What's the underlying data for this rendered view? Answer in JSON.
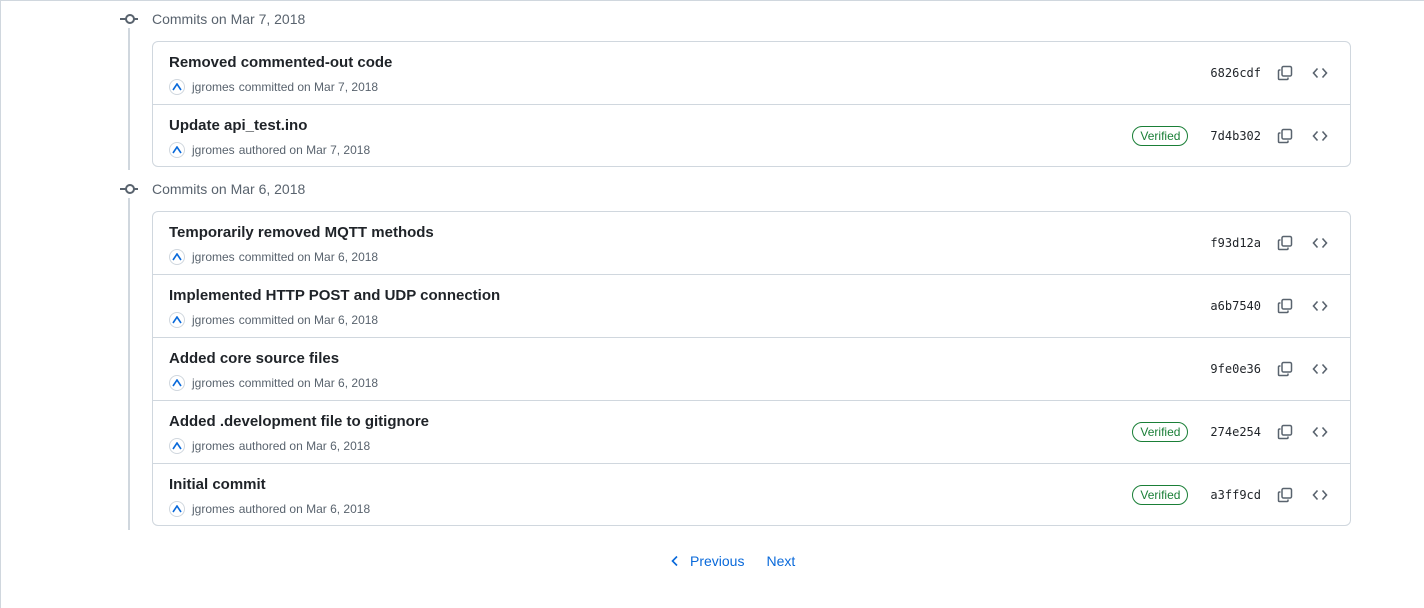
{
  "groups": [
    {
      "title": "Commits on Mar 7, 2018",
      "commits": [
        {
          "message": "Removed commented-out code",
          "author": "jgromes",
          "action": "committed on Mar 7, 2018",
          "verified": "",
          "sha": "6826cdf"
        },
        {
          "message": "Update api_test.ino",
          "author": "jgromes",
          "action": "authored on Mar 7, 2018",
          "verified": "Verified",
          "sha": "7d4b302"
        }
      ]
    },
    {
      "title": "Commits on Mar 6, 2018",
      "commits": [
        {
          "message": "Temporarily removed MQTT methods",
          "author": "jgromes",
          "action": "committed on Mar 6, 2018",
          "verified": "",
          "sha": "f93d12a"
        },
        {
          "message": "Implemented HTTP POST and UDP connection",
          "author": "jgromes",
          "action": "committed on Mar 6, 2018",
          "verified": "",
          "sha": "a6b7540"
        },
        {
          "message": "Added core source files",
          "author": "jgromes",
          "action": "committed on Mar 6, 2018",
          "verified": "",
          "sha": "9fe0e36"
        },
        {
          "message": "Added .development file to gitignore",
          "author": "jgromes",
          "action": "authored on Mar 6, 2018",
          "verified": "Verified",
          "sha": "274e254"
        },
        {
          "message": "Initial commit",
          "author": "jgromes",
          "action": "authored on Mar 6, 2018",
          "verified": "Verified",
          "sha": "a3ff9cd"
        }
      ]
    }
  ],
  "pagination": {
    "previous": "Previous",
    "next": "Next"
  },
  "colors": {
    "link": "#0969da",
    "verified": "#1a7f37",
    "border": "#d0d7de",
    "muted": "#59636e"
  },
  "icons": {
    "commit": "git-commit-icon",
    "copy": "copy-icon",
    "browse": "code-icon",
    "avatar": "avatar-icon",
    "prev": "chevron-left-icon"
  }
}
